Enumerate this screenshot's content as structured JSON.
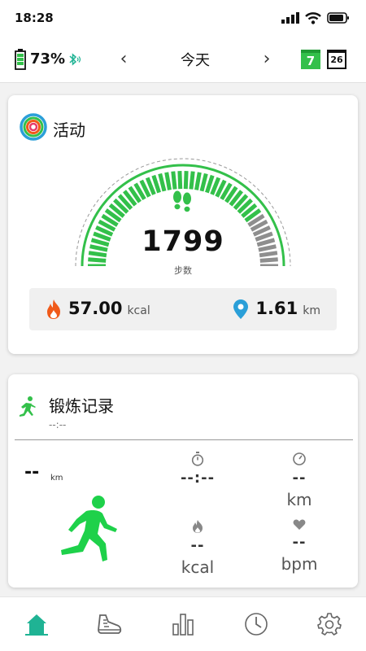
{
  "status_bar": {
    "time": "18:28"
  },
  "top_nav": {
    "battery_percent": "73%",
    "date_label": "今天",
    "prev_arrow": "‹",
    "next_arrow": "›",
    "calendar_day": "7",
    "calendar_month_day": "26"
  },
  "activity": {
    "title": "活动",
    "steps": "1799",
    "steps_label": "步数",
    "steps_progress": 0.82,
    "calories_value": "57.00",
    "calories_unit": "kcal",
    "distance_value": "1.61",
    "distance_unit": "km"
  },
  "workout": {
    "title": "锻炼记录",
    "time": "--:--",
    "distance_value": "--",
    "distance_unit": "km",
    "duration_value": "--:--",
    "pace_value": "--",
    "pace_unit": "km",
    "calories_value": "--",
    "calories_unit": "kcal",
    "heart_rate_value": "--",
    "heart_rate_unit": "bpm"
  },
  "colors": {
    "accent_green": "#33c04a",
    "teal": "#1fb394",
    "gray_track": "#8e8e8e",
    "fire": "#f05a1a",
    "location": "#2a9fd8"
  },
  "bottom_nav": {
    "items": [
      "home-icon",
      "shoe-icon",
      "bar-chart-icon",
      "clock-icon",
      "settings-icon"
    ]
  }
}
